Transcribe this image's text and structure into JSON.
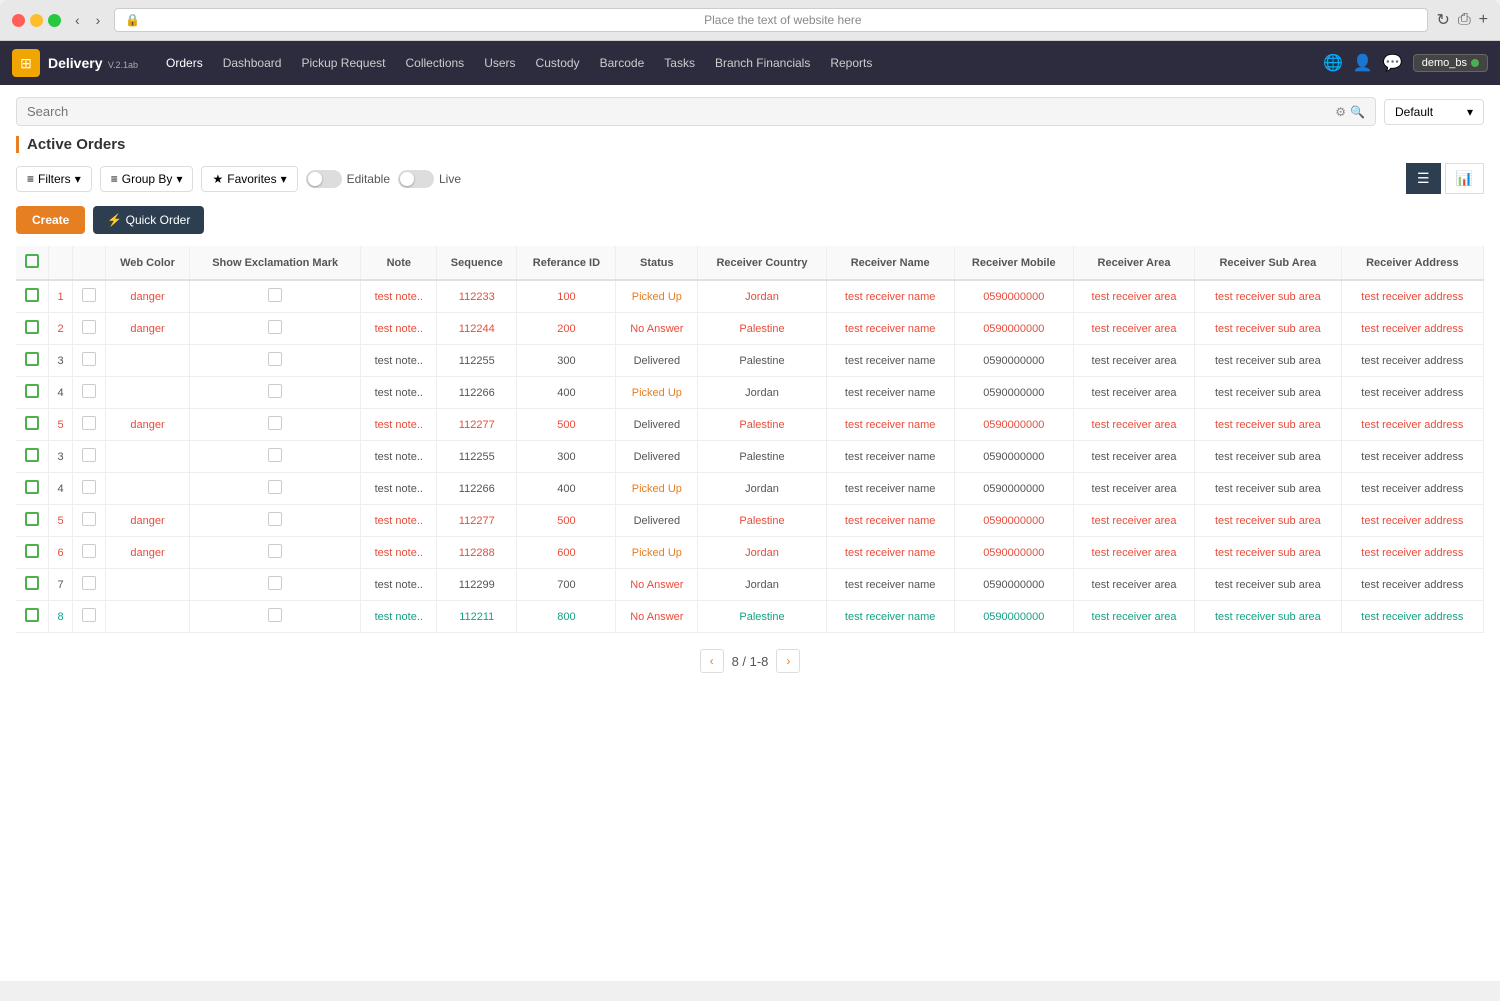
{
  "browser": {
    "address": "Place the text of website here",
    "lock_icon": "🔒"
  },
  "nav": {
    "brand": "Delivery",
    "brand_version": "V.2.1ab",
    "items": [
      "Orders",
      "Dashboard",
      "Pickup Request",
      "Collections",
      "Users",
      "Custody",
      "Barcode",
      "Tasks",
      "Branch Financials",
      "Reports"
    ],
    "user": "demo_bs"
  },
  "toolbar": {
    "search_placeholder": "Search",
    "default_label": "Default",
    "filters_label": "Filters",
    "group_by_label": "Group By",
    "favorites_label": "Favorites",
    "editable_label": "Editable",
    "live_label": "Live",
    "create_label": "Create",
    "quick_order_label": "⚡ Quick Order"
  },
  "page": {
    "title": "Active Orders"
  },
  "table": {
    "headers": [
      "",
      "Web Color",
      "Show Exclamation Mark",
      "Note",
      "Sequence",
      "Referance ID",
      "Status",
      "Receiver Country",
      "Receiver Name",
      "Receiver Mobile",
      "Receiver Area",
      "Receiver Sub Area",
      "Receiver Address"
    ],
    "rows": [
      {
        "num": 1,
        "web_color": "danger",
        "show_exclamation": "",
        "note": "test note..",
        "sequence": "112233",
        "ref_id": "100",
        "status": "Picked Up",
        "country": "Jordan",
        "receiver_name": "test receiver name",
        "mobile": "0590000000",
        "area": "test receiver area",
        "sub_area": "test receiver sub area",
        "address": "test receiver address",
        "color_class": "danger"
      },
      {
        "num": 2,
        "web_color": "danger",
        "show_exclamation": "",
        "note": "test note..",
        "sequence": "112244",
        "ref_id": "200",
        "status": "No Answer",
        "country": "Palestine",
        "receiver_name": "test receiver name",
        "mobile": "0590000000",
        "area": "test receiver area",
        "sub_area": "test receiver sub area",
        "address": "test receiver address",
        "color_class": "danger"
      },
      {
        "num": 3,
        "web_color": "",
        "show_exclamation": "",
        "note": "test note..",
        "sequence": "112255",
        "ref_id": "300",
        "status": "Delivered",
        "country": "Palestine",
        "receiver_name": "test receiver name",
        "mobile": "0590000000",
        "area": "test receiver area",
        "sub_area": "test receiver sub area",
        "address": "test receiver address",
        "color_class": "normal"
      },
      {
        "num": 4,
        "web_color": "",
        "show_exclamation": "",
        "note": "test note..",
        "sequence": "112266",
        "ref_id": "400",
        "status": "Picked Up",
        "country": "Jordan",
        "receiver_name": "test receiver name",
        "mobile": "0590000000",
        "area": "test receiver area",
        "sub_area": "test receiver sub area",
        "address": "test receiver address",
        "color_class": "normal"
      },
      {
        "num": 5,
        "web_color": "danger",
        "show_exclamation": "",
        "note": "test note..",
        "sequence": "112277",
        "ref_id": "500",
        "status": "Delivered",
        "country": "Palestine",
        "receiver_name": "test receiver name",
        "mobile": "0590000000",
        "area": "test receiver area",
        "sub_area": "test receiver sub area",
        "address": "test receiver address",
        "color_class": "danger"
      },
      {
        "num": 3,
        "web_color": "",
        "show_exclamation": "",
        "note": "test note..",
        "sequence": "112255",
        "ref_id": "300",
        "status": "Delivered",
        "country": "Palestine",
        "receiver_name": "test receiver name",
        "mobile": "0590000000",
        "area": "test receiver area",
        "sub_area": "test receiver sub area",
        "address": "test receiver address",
        "color_class": "normal"
      },
      {
        "num": 4,
        "web_color": "",
        "show_exclamation": "",
        "note": "test note..",
        "sequence": "112266",
        "ref_id": "400",
        "status": "Picked Up",
        "country": "Jordan",
        "receiver_name": "test receiver name",
        "mobile": "0590000000",
        "area": "test receiver area",
        "sub_area": "test receiver sub area",
        "address": "test receiver address",
        "color_class": "normal"
      },
      {
        "num": 5,
        "web_color": "danger",
        "show_exclamation": "",
        "note": "test note..",
        "sequence": "112277",
        "ref_id": "500",
        "status": "Delivered",
        "country": "Palestine",
        "receiver_name": "test receiver name",
        "mobile": "0590000000",
        "area": "test receiver area",
        "sub_area": "test receiver sub area",
        "address": "test receiver address",
        "color_class": "danger"
      },
      {
        "num": 6,
        "web_color": "danger",
        "show_exclamation": "",
        "note": "test note..",
        "sequence": "112288",
        "ref_id": "600",
        "status": "Picked Up",
        "country": "Jordan",
        "receiver_name": "test receiver name",
        "mobile": "0590000000",
        "area": "test receiver area",
        "sub_area": "test receiver sub area",
        "address": "test receiver address",
        "color_class": "danger"
      },
      {
        "num": 7,
        "web_color": "",
        "show_exclamation": "",
        "note": "test note..",
        "sequence": "112299",
        "ref_id": "700",
        "status": "No Answer",
        "country": "Jordan",
        "receiver_name": "test receiver name",
        "mobile": "0590000000",
        "area": "test receiver area",
        "sub_area": "test receiver sub area",
        "address": "test receiver address",
        "color_class": "normal"
      },
      {
        "num": 8,
        "web_color": "",
        "show_exclamation": "",
        "note": "test note..",
        "sequence": "112211",
        "ref_id": "800",
        "status": "No Answer",
        "country": "Palestine",
        "receiver_name": "test receiver name",
        "mobile": "0590000000",
        "area": "test receiver area",
        "sub_area": "test receiver sub area",
        "address": "test receiver address",
        "color_class": "teal"
      }
    ]
  },
  "pagination": {
    "current": "8 / 1-8"
  }
}
